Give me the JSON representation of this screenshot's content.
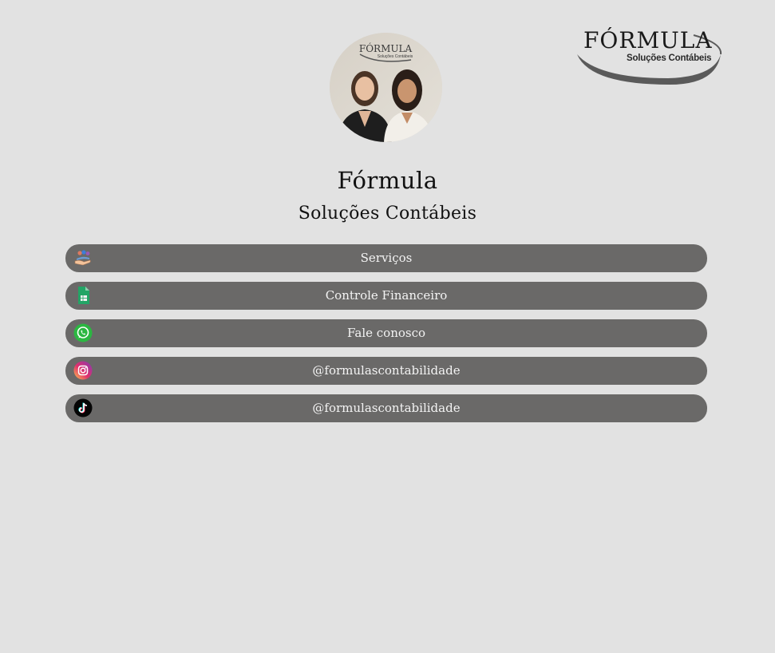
{
  "logo": {
    "word": "FÓRMULA",
    "sub": "Soluções Contábeis"
  },
  "avatar": {
    "sign_word": "FÓRMULA",
    "sign_sub": "Soluções Contábeis"
  },
  "profile": {
    "title": "Fórmula",
    "subtitle": "Soluções Contábeis"
  },
  "links": [
    {
      "label": "Serviços",
      "icon": "services-hand-icon"
    },
    {
      "label": "Controle Financeiro",
      "icon": "spreadsheet-icon"
    },
    {
      "label": "Fale conosco",
      "icon": "whatsapp-icon"
    },
    {
      "label": "@formulascontabilidade",
      "icon": "instagram-icon"
    },
    {
      "label": "@formulascontabilidade",
      "icon": "tiktok-icon"
    }
  ],
  "colors": {
    "background": "#e2e2e2",
    "button": "#6a6968",
    "button_text": "#f4f4f4"
  }
}
